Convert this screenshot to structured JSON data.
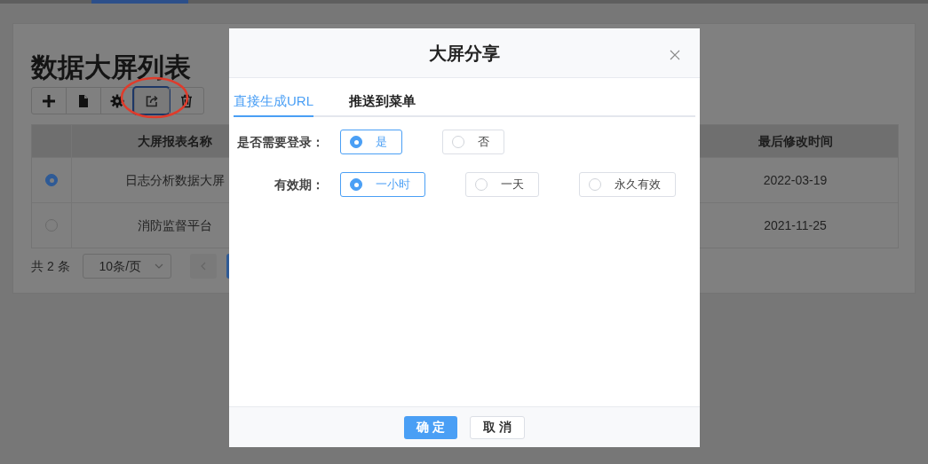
{
  "page": {
    "title": "数据大屏列表",
    "toolbar": [
      {
        "kind": "plus",
        "selected": false
      },
      {
        "kind": "file",
        "selected": false
      },
      {
        "kind": "gear",
        "selected": false
      },
      {
        "kind": "share",
        "selected": true
      },
      {
        "kind": "trash",
        "selected": false
      }
    ],
    "table": {
      "columns": [
        "大屏报表名称",
        "最后修改时间"
      ],
      "rows": [
        {
          "selected": true,
          "name": "日志分析数据大屏",
          "modified": "2022-03-19"
        },
        {
          "selected": false,
          "name": "消防监督平台",
          "modified": "2021-11-25"
        }
      ]
    },
    "pagination": {
      "total": "共 2 条",
      "page_size": "10条/页"
    }
  },
  "dialog": {
    "title": "大屏分享",
    "tabs": [
      {
        "label": "直接生成URL",
        "selected": true
      },
      {
        "label": "推送到菜单",
        "selected": false
      }
    ],
    "fields": [
      {
        "label": "是否需要登录：",
        "options": [
          {
            "label": "是",
            "selected": true
          },
          {
            "label": "否",
            "selected": false
          }
        ]
      },
      {
        "label": "有效期：",
        "options": [
          {
            "label": "一小时",
            "selected": true
          },
          {
            "label": "一天",
            "selected": false
          },
          {
            "label": "永久有效",
            "selected": false
          }
        ]
      }
    ],
    "buttons": [
      {
        "label": "确 定",
        "kind": "primary"
      },
      {
        "label": "取 消",
        "kind": "default"
      }
    ]
  }
}
